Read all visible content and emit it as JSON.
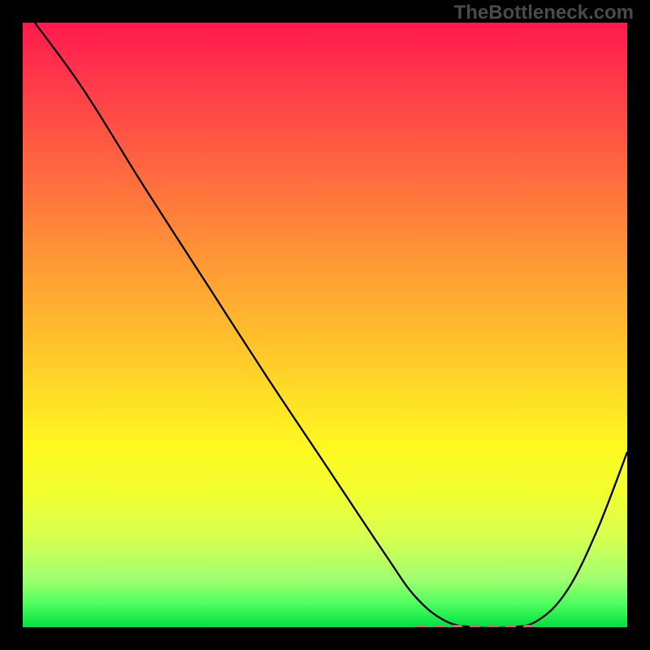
{
  "watermark": "TheBottleneck.com",
  "chart_data": {
    "type": "line",
    "title": "",
    "xlabel": "",
    "ylabel": "",
    "xlim": [
      0,
      100
    ],
    "ylim": [
      0,
      100
    ],
    "series": [
      {
        "name": "curve",
        "x": [
          2,
          10,
          20,
          30,
          40,
          50,
          60,
          65,
          70,
          75,
          80,
          85,
          90,
          95,
          100
        ],
        "y": [
          100,
          89,
          73,
          57.5,
          42,
          27,
          12,
          5,
          1,
          0,
          0,
          1,
          6,
          16,
          29
        ]
      }
    ],
    "marker_band": {
      "name": "optimum-range",
      "x_start": 65,
      "x_end": 85,
      "y": 0,
      "color": "#d96a6a"
    },
    "background_gradient": {
      "stops": [
        {
          "pos": 0.0,
          "color": "#ff1a4d"
        },
        {
          "pos": 0.25,
          "color": "#ff6a3f"
        },
        {
          "pos": 0.55,
          "color": "#ffc92a"
        },
        {
          "pos": 0.78,
          "color": "#f0ff30"
        },
        {
          "pos": 0.96,
          "color": "#50ff60"
        },
        {
          "pos": 1.0,
          "color": "#00e040"
        }
      ]
    }
  }
}
